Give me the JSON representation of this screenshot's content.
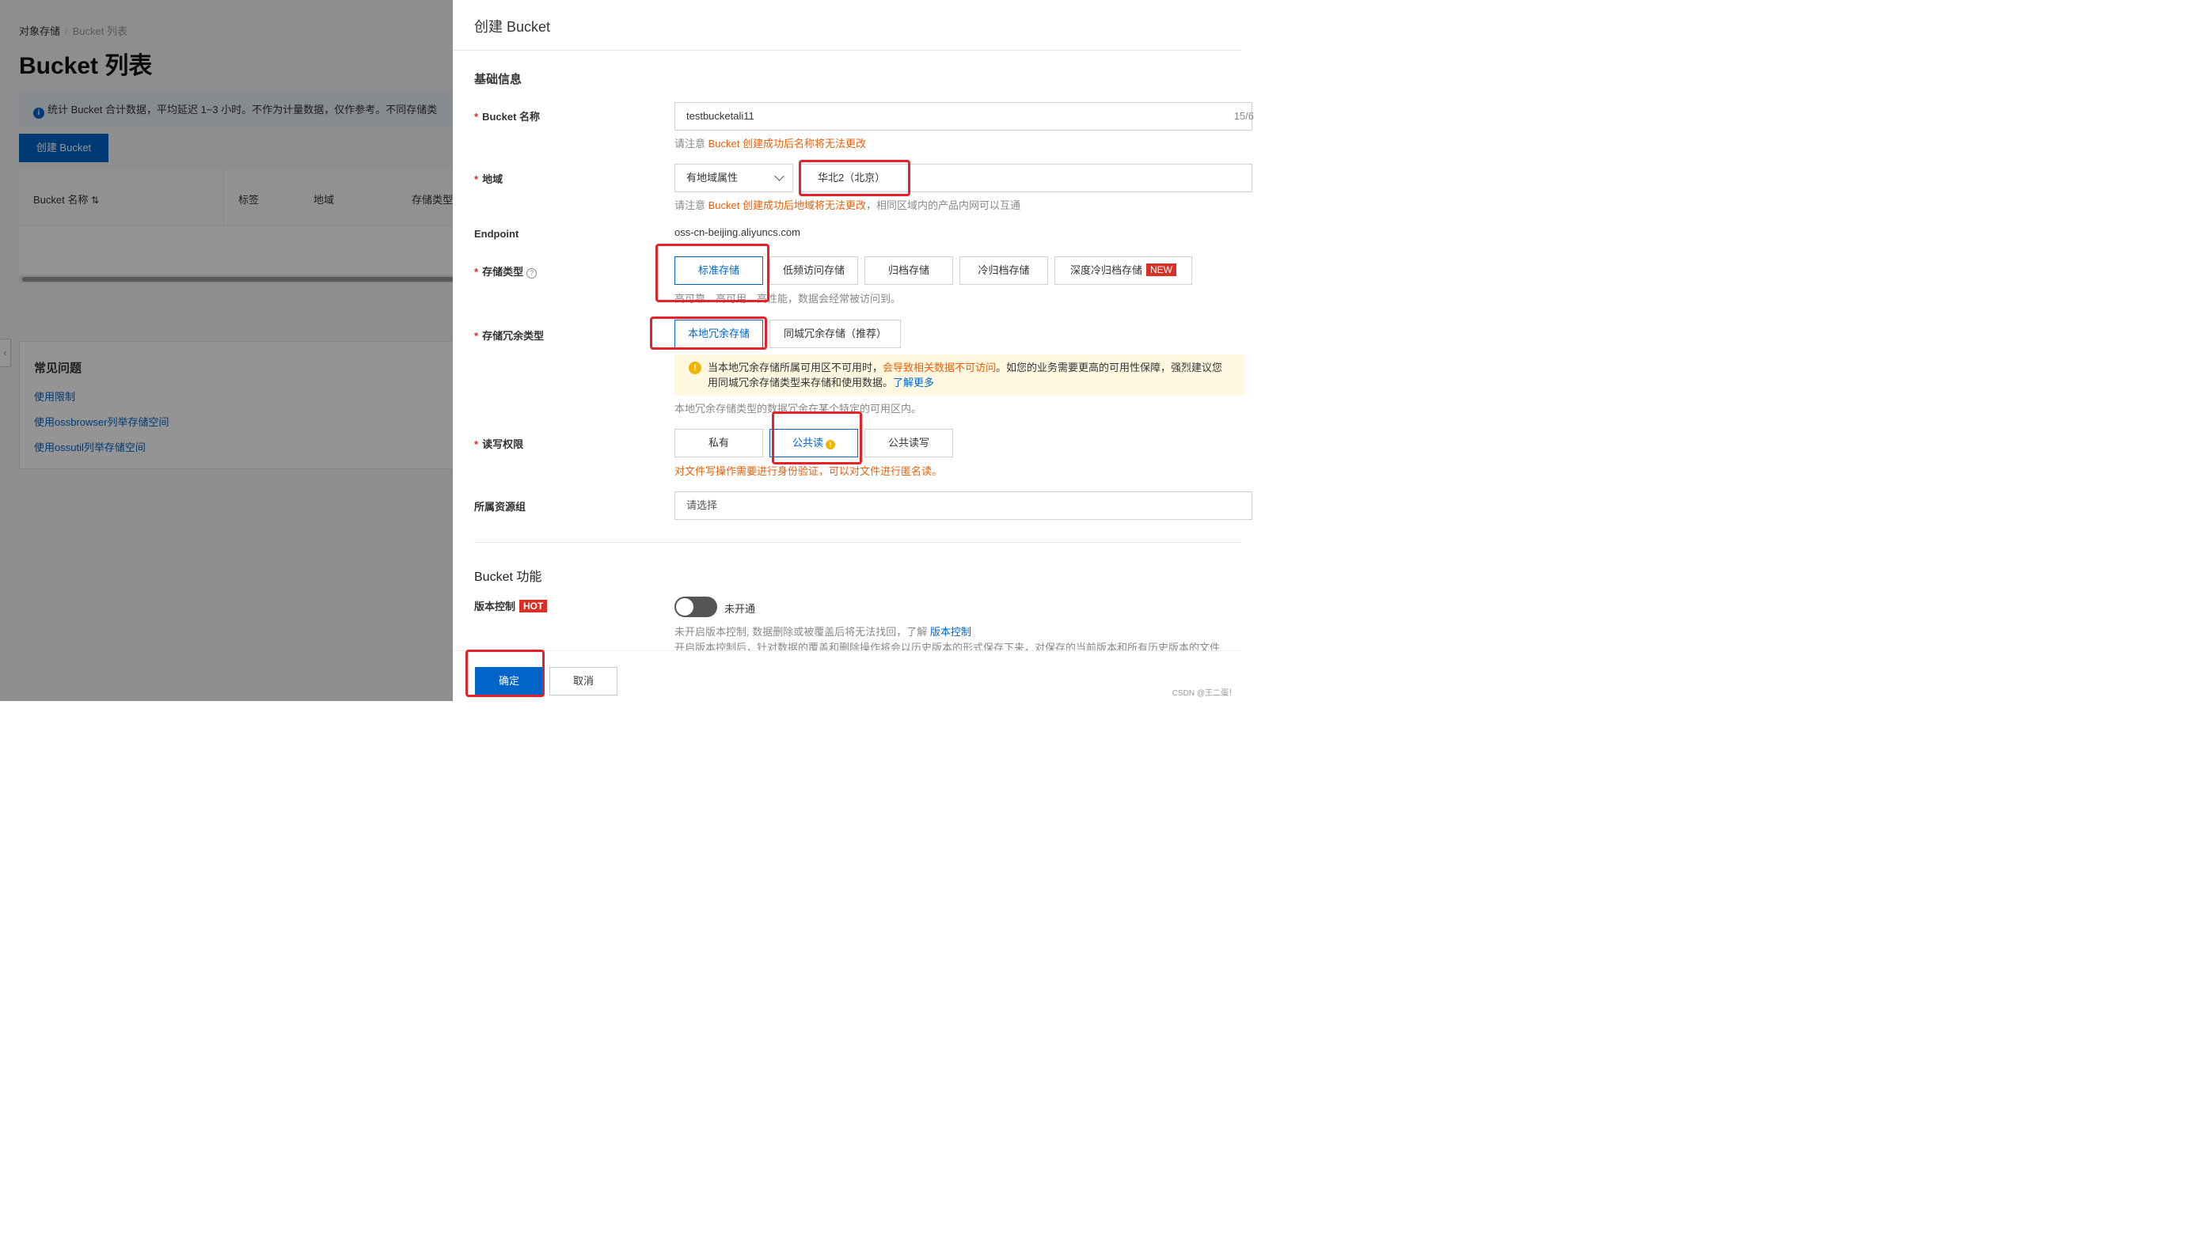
{
  "background_page": {
    "breadcrumb": {
      "root": "对象存储",
      "separator": "/",
      "current": "Bucket 列表"
    },
    "title": "Bucket 列表",
    "notice": "统计 Bucket 合计数据，平均延迟 1~3 小时。不作为计量数据，仅作参考。不同存储类",
    "create_button": "创建 Bucket",
    "table_headers": [
      "Bucket 名称",
      "标签",
      "地域",
      "存储类型"
    ],
    "sort_icon": "sort-icon",
    "faq": {
      "title": "常见问题",
      "links": [
        "使用限制",
        "使用ossbrowser列举存储空间",
        "使用ossutil列举存储空间"
      ]
    }
  },
  "drawer": {
    "title": "创建 Bucket",
    "basic_info_title": "基础信息",
    "bucket_name": {
      "label": "Bucket 名称",
      "value": "testbucketali11",
      "counter": "15/6",
      "hint_prefix": "请注意 ",
      "hint_warn": "Bucket 创建成功后名称将无法更改"
    },
    "region": {
      "label": "地域",
      "type_select": "有地域属性",
      "value": "华北2（北京）",
      "hint_prefix": "请注意 ",
      "hint_warn": "Bucket 创建成功后地域将无法更改",
      "hint_suffix": "，相同区域内的产品内网可以互通"
    },
    "endpoint": {
      "label": "Endpoint",
      "value": "oss-cn-beijing.aliyuncs.com"
    },
    "storage_class": {
      "label": "存储类型",
      "options": [
        "标准存储",
        "低频访问存储",
        "归档存储",
        "冷归档存储",
        "深度冷归档存储"
      ],
      "new_badge": "NEW",
      "selected": "标准存储",
      "hint": "高可靠、高可用、高性能，数据会经常被访问到。"
    },
    "redundancy": {
      "label": "存储冗余类型",
      "options": [
        "本地冗余存储",
        "同城冗余存储（推荐）"
      ],
      "selected": "本地冗余存储",
      "warning_1a": "当本地冗余存储所属可用区不可用时，",
      "warning_1b": "会导致相关数据不可访问",
      "warning_1c": "。如您的业务需要更高的可用性保障，强烈建议您",
      "warning_2": "用同城冗余存储类型来存储和使用数据。",
      "warning_link": "了解更多",
      "hint": "本地冗余存储类型的数据冗余在某个特定的可用区内。"
    },
    "acl": {
      "label": "读写权限",
      "options": [
        "私有",
        "公共读",
        "公共读写"
      ],
      "selected": "公共读",
      "hint": "对文件写操作需要进行身份验证，可以对文件进行匿名读。"
    },
    "resource_group": {
      "label": "所属资源组",
      "placeholder": "请选择"
    },
    "features_title": "Bucket 功能",
    "versioning": {
      "label": "版本控制",
      "hot_badge": "HOT",
      "status": "未开通",
      "hint1": "未开启版本控制, 数据删除或被覆盖后将无法找回，了解 ",
      "hint1_link": "版本控制",
      "hint2": "开启版本控制后，针对数据的覆盖和删除操作将会以历史版本的形式保存下来，对保存的当前版本和所有历史版本的文件"
    },
    "confirm_button": "确定",
    "cancel_button": "取消"
  },
  "watermark": "CSDN @王二蛋！",
  "colors": {
    "primary": "#0064c8",
    "warning": "#e5610d",
    "danger": "#d93026",
    "highlight": "#e8202a"
  }
}
